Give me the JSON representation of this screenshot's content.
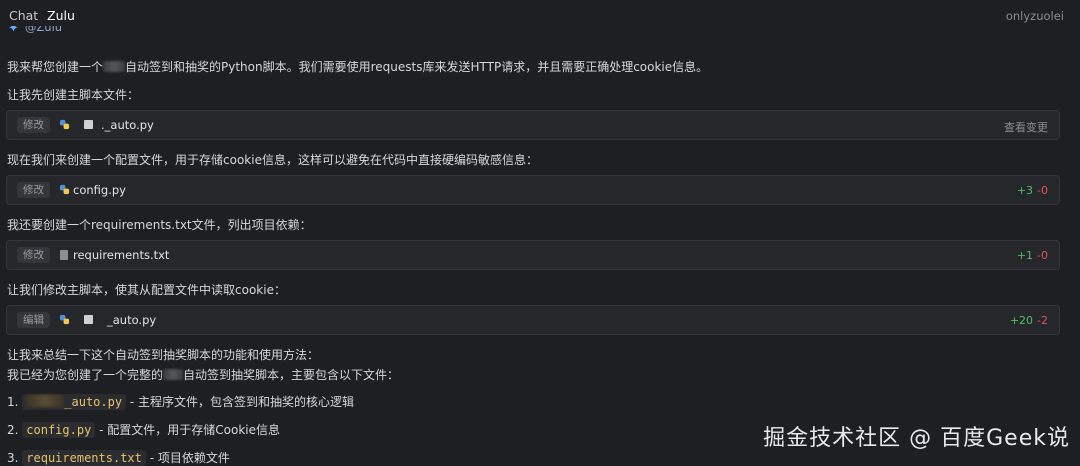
{
  "topbar": {
    "tab_chat": "Chat",
    "tab_zulu": "Zulu",
    "user": "onlyzuolei"
  },
  "agent": {
    "name": "@Zulu"
  },
  "messages": {
    "intro_pre": "我来帮您创建一个",
    "intro_post": "自动签到和抽奖的Python脚本。我们需要使用requests库来发送HTTP请求，并且需要正确处理cookie信息。",
    "create_main": "让我先创建主脚本文件：",
    "create_config": "现在我们来创建一个配置文件，用于存储cookie信息，这样可以避免在代码中直接硬编码敏感信息：",
    "create_req": "我还要创建一个requirements.txt文件，列出项目依赖：",
    "modify_main": "让我们修改主脚本，使其从配置文件中读取cookie：",
    "summary_1": "让我来总结一下这个自动签到抽奖脚本的功能和使用方法：",
    "summary_2_pre": "我已经为您创建了一个完整的",
    "summary_2_post": "自动签到抽奖脚本，主要包含以下文件："
  },
  "cards": [
    {
      "action": "修改",
      "file": "._auto.py",
      "view": "查看变更"
    },
    {
      "action": "修改",
      "file": "config.py",
      "added": "+3",
      "removed": "-0"
    },
    {
      "action": "修改",
      "file": "requirements.txt",
      "added": "+1",
      "removed": "-0"
    },
    {
      "action": "编辑",
      "file": "_auto.py",
      "added": "+20",
      "removed": "-2"
    }
  ],
  "list": [
    {
      "num": "1.",
      "code": "_auto.py",
      "desc": " - 主程序文件，包含签到和抽奖的核心逻辑"
    },
    {
      "num": "2.",
      "code": "config.py",
      "desc": " - 配置文件，用于存储Cookie信息"
    },
    {
      "num": "3.",
      "code": "requirements.txt",
      "desc": " - 项目依赖文件"
    }
  ],
  "watermark": "掘金技术社区 @ 百度Geek说",
  "colors": {
    "background": "#1e1f22",
    "added": "#4fbf62",
    "removed": "#e05454",
    "code": "#e8c26a"
  }
}
